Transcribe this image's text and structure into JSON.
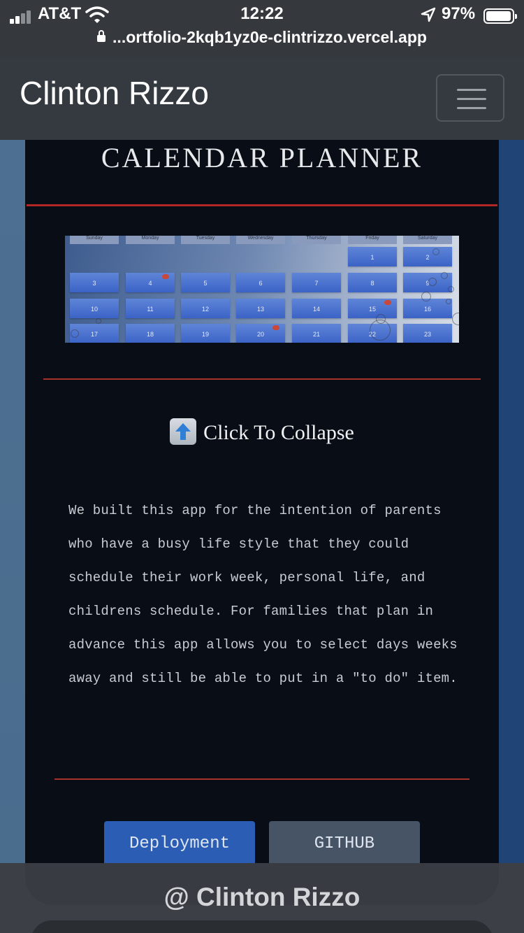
{
  "status_bar": {
    "carrier": "AT&T",
    "time": "12:22",
    "battery": "97%",
    "battery_level": 0.97,
    "url": "...ortfolio-2kqb1yz0e-clintrizzo.vercel.app"
  },
  "navbar": {
    "brand": "Clinton Rizzo",
    "toggle_icon": "hamburger-icon"
  },
  "project": {
    "title": "CALENDAR PLANNER",
    "calendar_preview": {
      "days": [
        "Sunday",
        "Monday",
        "Tuesday",
        "Wednesday",
        "Thursday",
        "Friday",
        "Saturday"
      ],
      "dates": [
        "1",
        "2",
        "3",
        "4",
        "5",
        "6",
        "7",
        "8",
        "9",
        "10",
        "11",
        "12",
        "13",
        "14",
        "15",
        "16",
        "17",
        "18",
        "19",
        "20",
        "21",
        "22",
        "23"
      ],
      "event_dates": [
        "4",
        "15",
        "20"
      ]
    },
    "collapse_label": "Click To Collapse",
    "collapse_icon": "up-arrow-icon",
    "description": "We built this app for the intention of parents who have a busy life style that they could schedule their work week, personal life, and childrens schedule. For families that plan in advance this app allows you to select days weeks away and still be able to put in a \"to do\" item.",
    "buttons": {
      "deployment": "Deployment",
      "github": "GITHUB"
    },
    "colors": {
      "accent_rule": "#b32626",
      "deploy_button": "#2a5db3",
      "github_button": "#465466"
    }
  },
  "footer": {
    "text": "@ Clinton Rizzo"
  }
}
